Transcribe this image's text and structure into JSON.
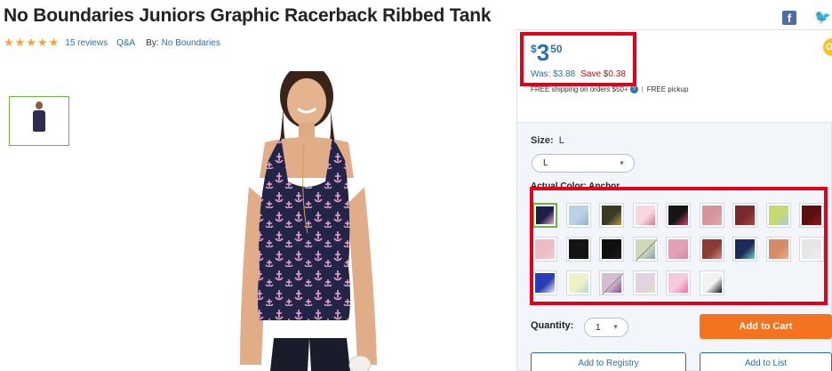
{
  "product": {
    "title": "No Boundaries Juniors Graphic Racerback Ribbed Tank",
    "stars": "★★★★★",
    "reviews_text": "15 reviews",
    "qa_text": "Q&A",
    "by_label": "By:",
    "brand": "No Boundaries",
    "rating": 4.5
  },
  "social": {
    "facebook": "f",
    "twitter": "🐦"
  },
  "price": {
    "currency": "$",
    "whole": "3",
    "cents": "50",
    "was": "Was: $3.88",
    "save": "Save $0.38",
    "shipping": "FREE shipping on orders $50+",
    "info_icon": "?",
    "separator": "|",
    "pickup": "FREE pickup"
  },
  "options": {
    "size_label": "Size:",
    "size_value": "L",
    "size_selected": "L",
    "color_label": "Actual Color: Anchor",
    "swatches": [
      {
        "name": "anchor-navy",
        "colors": [
          "#1d1f44",
          "#e8a9cf"
        ],
        "selected": true,
        "unavailable": false
      },
      {
        "name": "sky-light",
        "colors": [
          "#bcd2e4",
          "#8fb0cb"
        ]
      },
      {
        "name": "olive-print",
        "colors": [
          "#3a3a22",
          "#b99b45"
        ]
      },
      {
        "name": "pink-scribble",
        "colors": [
          "#f7d9df",
          "#d27b8f"
        ]
      },
      {
        "name": "black-pink-floral",
        "colors": [
          "#151515",
          "#d93f7a"
        ]
      },
      {
        "name": "dusty-pink",
        "colors": [
          "#d6959c",
          "#e2aab0"
        ]
      },
      {
        "name": "burgundy-stripe",
        "colors": [
          "#7a2a2a",
          "#a84b43"
        ]
      },
      {
        "name": "pastel-tie-dye",
        "colors": [
          "#c8d873",
          "#a6c8e8"
        ]
      },
      {
        "name": "black-red",
        "colors": [
          "#5a0f12",
          "#9a1a1d"
        ]
      },
      {
        "name": "light-pink",
        "colors": [
          "#ecbcc4",
          "#f2cdd3"
        ]
      },
      {
        "name": "solid-black",
        "colors": [
          "#141414",
          "#141414"
        ]
      },
      {
        "name": "black-2",
        "colors": [
          "#0f0f0f",
          "#1b1b1b"
        ]
      },
      {
        "name": "mint-print",
        "colors": [
          "#cfd9b8",
          "#7ea1b8"
        ],
        "unavailable": true
      },
      {
        "name": "pink-rose",
        "colors": [
          "#e3a1b8",
          "#d9859f"
        ]
      },
      {
        "name": "leopard-pink",
        "colors": [
          "#8b3a36",
          "#d48a7c"
        ]
      },
      {
        "name": "neon-navy",
        "colors": [
          "#1c2b5a",
          "#6dd0c7"
        ]
      },
      {
        "name": "coral-aztec",
        "colors": [
          "#d58a6a",
          "#e7b08f"
        ]
      },
      {
        "name": "heather-white",
        "colors": [
          "#e6e6e6",
          "#eeeeee"
        ]
      },
      {
        "name": "royal-anchor",
        "colors": [
          "#2a3eb4",
          "#e9ecf7"
        ]
      },
      {
        "name": "lemon-mint",
        "colors": [
          "#eef2c9",
          "#b8d5d8"
        ]
      },
      {
        "name": "pink-purple",
        "colors": [
          "#d6bcd2",
          "#8a4c8e"
        ],
        "unavailable": true
      },
      {
        "name": "pastel-mix",
        "colors": [
          "#e2d2e2",
          "#d7e3bd"
        ]
      },
      {
        "name": "hot-pink-heart",
        "colors": [
          "#f6c9dc",
          "#f06aa7"
        ]
      },
      {
        "name": "black-skull",
        "colors": [
          "#f2f2f2",
          "#111111"
        ]
      }
    ]
  },
  "purchase": {
    "quantity_label": "Quantity:",
    "quantity_value": "1",
    "add_to_cart": "Add to Cart",
    "add_to_registry": "Add to Registry",
    "add_to_list": "Add to List"
  },
  "promo_badge": "G"
}
